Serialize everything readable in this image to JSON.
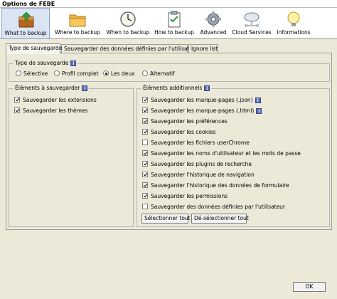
{
  "window": {
    "title": "Options de FEBE"
  },
  "toolbar": {
    "items": [
      {
        "label": "What to backup",
        "icon": "backup-box-icon"
      },
      {
        "label": "Where to backup",
        "icon": "folder-icon"
      },
      {
        "label": "When to backup",
        "icon": "clock-icon"
      },
      {
        "label": "How to backup",
        "icon": "checklist-icon"
      },
      {
        "label": "Advanced",
        "icon": "gear-icon"
      },
      {
        "label": "Cloud Services",
        "icon": "cloud-network-icon"
      },
      {
        "label": "Informations",
        "icon": "info-bulb-icon"
      }
    ],
    "selected": "What to backup"
  },
  "tabs": [
    {
      "label": "Type de sauvegarde",
      "active": true
    },
    {
      "label": "Sauvegarder des données définies par l'utilisateur",
      "active": false
    },
    {
      "label": "Ignore list",
      "active": false
    }
  ],
  "backup_type": {
    "legend": "Type de sauvegarde",
    "options": [
      "Sélective",
      "Profil complet",
      "Les deux",
      "Alternatif"
    ],
    "selected": "Les deux"
  },
  "elements": {
    "legend": "Éléments à sauvegarder",
    "items": [
      {
        "label": "Sauvegarder les extensions",
        "checked": true
      },
      {
        "label": "Sauvegarder les thèmes",
        "checked": true
      }
    ]
  },
  "additional": {
    "legend": "Éléments additionnels",
    "items": [
      {
        "label": "Sauvegarder les marque-pages (.json)",
        "checked": true,
        "info": true
      },
      {
        "label": "Sauvegarder les marque-pages (.html)",
        "checked": true,
        "info": true
      },
      {
        "label": "Sauvegarder les préférences",
        "checked": true,
        "info": false
      },
      {
        "label": "Sauvegarder les cookies",
        "checked": true,
        "info": false
      },
      {
        "label": "Sauvegarder les fichiers userChrome",
        "checked": false,
        "info": false
      },
      {
        "label": "Sauvegarder les noms d'utilisateur et les mots de passe",
        "checked": true,
        "info": false
      },
      {
        "label": "Sauvegarder les plugins de recherche",
        "checked": true,
        "info": false
      },
      {
        "label": "Sauvegarder l'historique de navigation",
        "checked": true,
        "info": false
      },
      {
        "label": "Sauvegarder l'historique des données de formulaire",
        "checked": true,
        "info": false
      },
      {
        "label": "Sauvegarder les permissions",
        "checked": true,
        "info": false
      },
      {
        "label": "Sauvegarder des données définies par l'utilisateur",
        "checked": false,
        "info": false
      }
    ],
    "select_all": "Sélectionner tout",
    "deselect_all": "Dé-sélectionner tout"
  },
  "footer": {
    "ok": "OK"
  },
  "info_glyph": "i"
}
